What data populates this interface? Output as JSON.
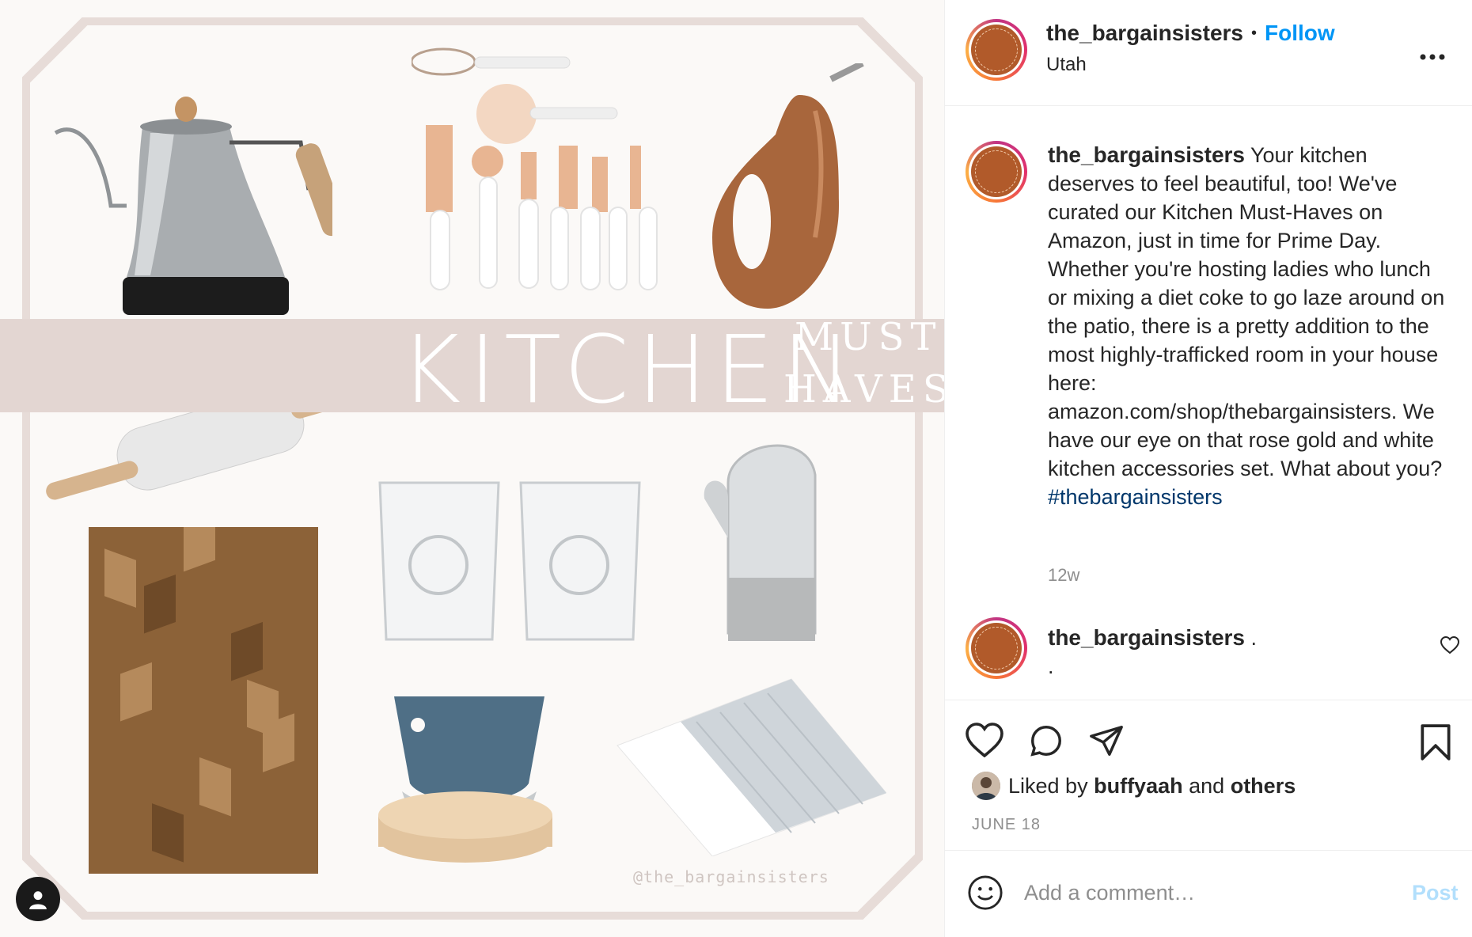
{
  "image": {
    "band_title": "KITCHEN",
    "band_must": "MUST",
    "band_haves": "HAVES",
    "watermark": "@the_bargainsisters",
    "products": [
      "kettle-icon",
      "utensil-set-icon",
      "oil-pitcher-icon",
      "rolling-pin-icon",
      "cutting-board-icon",
      "glasses-icon",
      "oven-mitts-icon",
      "mezzaluna-icon",
      "towel-icon"
    ],
    "user_tag_icon": "person-icon"
  },
  "header": {
    "username": "the_bargainsisters",
    "separator": "•",
    "follow_label": "Follow",
    "location": "Utah",
    "more_icon": "more-icon"
  },
  "caption": {
    "username": "the_bargainsisters",
    "text": "Your kitchen deserves to feel beautiful, too! We've curated our Kitchen Must-Haves on Amazon, just in time for Prime Day. Whether you're hosting ladies who lunch or mixing a diet coke to go laze around on the patio, there is a pretty addition to the most highly-trafficked room in your house here: amazon.com/shop/thebargainsisters. We have our eye on that rose gold and white kitchen accessories set. What about you?",
    "hashtag": "#thebargainsisters",
    "time": "12w"
  },
  "comment": {
    "username": "the_bargainsisters",
    "text_line1": ".",
    "text_line2": "."
  },
  "actions": {
    "liked_prefix": "Liked by",
    "liked_user": "buffyaah",
    "liked_and": "and",
    "liked_others": "others",
    "date": "JUNE 18"
  },
  "comment_box": {
    "placeholder": "Add a comment…",
    "post_label": "Post"
  },
  "colors": {
    "accent": "#0095f6",
    "band": "#e3d6d2",
    "avatar_brown": "#b15a2a",
    "hashtag": "#00376b",
    "muted": "#8e8e8e"
  }
}
